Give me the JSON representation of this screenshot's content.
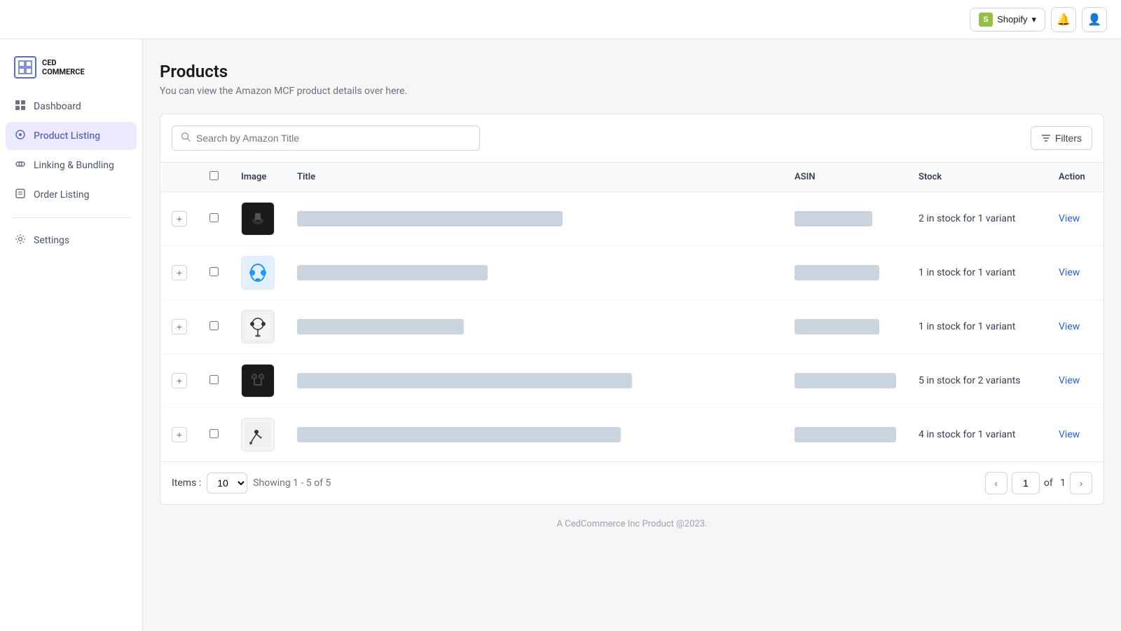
{
  "topbar": {
    "shopify_label": "Shopify",
    "shopify_icon": "S",
    "bell_icon": "🔔",
    "user_icon": "👤"
  },
  "sidebar": {
    "logo_line1": "CED",
    "logo_line2": "COMMERCE",
    "nav_items": [
      {
        "id": "dashboard",
        "label": "Dashboard",
        "icon": "⌂",
        "active": false
      },
      {
        "id": "product-listing",
        "label": "Product Listing",
        "icon": "◈",
        "active": true
      },
      {
        "id": "linking-bundling",
        "label": "Linking & Bundling",
        "icon": "🔗",
        "active": false
      },
      {
        "id": "order-listing",
        "label": "Order Listing",
        "icon": "☰",
        "active": false
      },
      {
        "id": "settings",
        "label": "Settings",
        "icon": "⚙",
        "active": false
      }
    ]
  },
  "page": {
    "title": "Products",
    "subtitle": "You can view the Amazon MCF product details over here."
  },
  "search": {
    "placeholder": "Search by Amazon Title"
  },
  "filters_label": "Filters",
  "table": {
    "columns": [
      "Image",
      "Title",
      "ASIN",
      "Stock",
      "Action"
    ],
    "rows": [
      {
        "id": 1,
        "title_blurred": "████████████ ████ ████████ ████████ ███████",
        "asin_blurred": "██ ████████",
        "stock": "2 in stock for 1 variant",
        "action": "View",
        "img_type": "speaker"
      },
      {
        "id": 2,
        "title_blurred": "██ █ ███ ██ ██████████████ ████",
        "asin_blurred": "██ █████████",
        "stock": "1 in stock for 1 variant",
        "action": "View",
        "img_type": "headphones-blue"
      },
      {
        "id": 3,
        "title_blurred": "██ ███████ ██████ ████████",
        "asin_blurred": "████████ ███",
        "stock": "1 in stock for 1 variant",
        "action": "View",
        "img_type": "headset"
      },
      {
        "id": 4,
        "title_blurred": "██ ███████ ██ ████ ████ ███████ ████████████ ████ ████ █",
        "asin_blurred": "██████████████",
        "stock": "5 in stock for 2 variants",
        "action": "View",
        "img_type": "earbuds"
      },
      {
        "id": 5,
        "title_blurred": "██ ████ █████ ████ ███████ ████████████ ████████ ████",
        "asin_blurred": "██████████████",
        "stock": "4 in stock for 1 variant",
        "action": "View",
        "img_type": "earphones"
      }
    ]
  },
  "pagination": {
    "items_label": "Items :",
    "items_value": "10",
    "showing_text": "Showing 1 - 5 of 5",
    "current_page": "1",
    "total_pages": "1",
    "of_label": "of"
  },
  "footer": {
    "text": "A CedCommerce Inc Product @2023."
  }
}
